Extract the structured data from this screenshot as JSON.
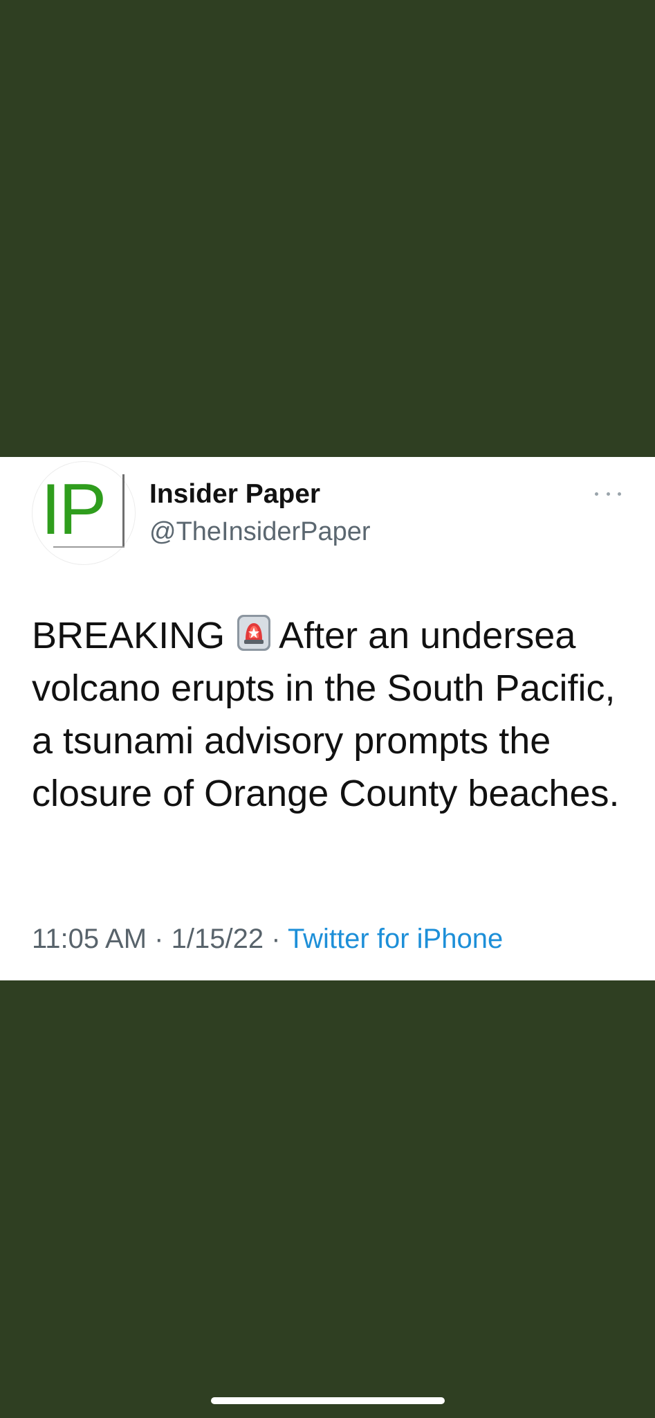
{
  "tweet": {
    "author": {
      "display_name": "Insider Paper",
      "handle": "@TheInsiderPaper",
      "avatar_logo_text": "IP"
    },
    "more_icon": "ellipsis-icon",
    "text_before_emoji": "BREAKING",
    "emoji": "rotating-light-icon",
    "text_after_emoji": "After an undersea volcano erupts in the South Pacific, a tsunami advisory prompts the closure of Orange County beaches.",
    "time": "11:05 AM",
    "separator": "·",
    "date": "1/15/22",
    "source": "Twitter for iPhone"
  },
  "colors": {
    "background": "#2f3f22",
    "card": "#ffffff",
    "logo_green": "#2f9d1d",
    "link_blue": "#1d8fd8",
    "muted_text": "#58636b"
  }
}
